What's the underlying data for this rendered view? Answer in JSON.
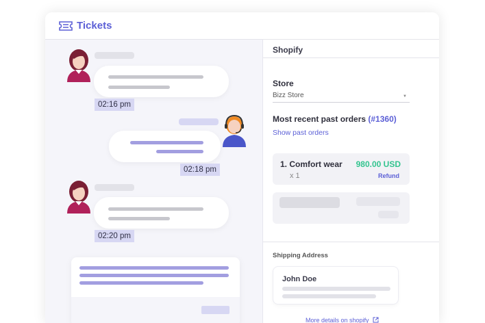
{
  "header": {
    "title": "Tickets",
    "icon": "ticket-icon",
    "accent": "#5b5fd6"
  },
  "chat": {
    "timestamps": [
      "02:16 pm",
      "02:18 pm",
      "02:20 pm"
    ]
  },
  "shopify": {
    "title": "Shopify",
    "store_label": "Store",
    "store_value": "Bizz Store",
    "recent_label": "Most recent past orders",
    "recent_order": "(#1360)",
    "show_past": "Show past orders",
    "order": {
      "name": "1. Comfort wear",
      "qty": "x 1",
      "price": "980.00 USD",
      "refund": "Refund"
    },
    "shipping_title": "Shipping Address",
    "address_name": "John Doe",
    "more_details": "More details on shopify"
  },
  "colors": {
    "price": "#33c48f",
    "timestamp_bg": "#d7d7f3",
    "chat_bg": "#f5f5fa"
  }
}
